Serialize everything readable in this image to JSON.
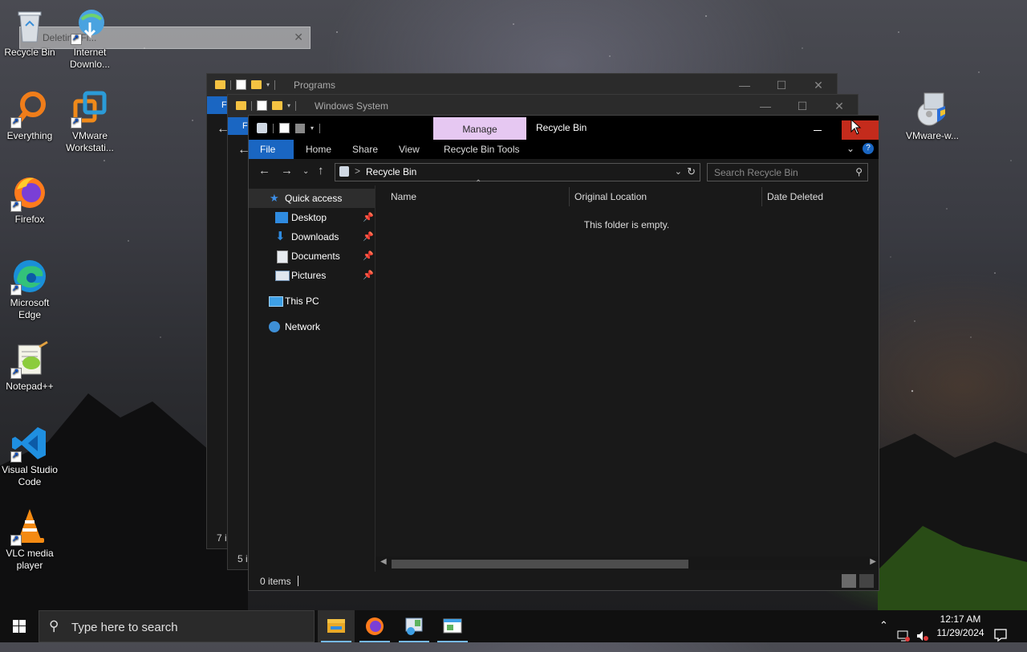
{
  "desktop": {
    "icons": [
      {
        "label": "Recycle Bin",
        "icon": "recycle-bin-icon"
      },
      {
        "label": "Internet Downlo...",
        "icon": "internet-download-manager-icon"
      },
      {
        "label": "Everything",
        "icon": "everything-search-icon"
      },
      {
        "label": "VMware Workstati...",
        "icon": "vmware-workstation-icon"
      },
      {
        "label": "Firefox",
        "icon": "firefox-icon"
      },
      {
        "label": "Microsoft Edge",
        "icon": "edge-icon"
      },
      {
        "label": "Notepad++",
        "icon": "notepad-plus-plus-icon"
      },
      {
        "label": "Visual Studio Code",
        "icon": "vscode-icon"
      },
      {
        "label": "VLC media player",
        "icon": "vlc-icon"
      },
      {
        "label": "VMware-w...",
        "icon": "vmware-installer-icon"
      }
    ],
    "ghost_dialog_title": "Deleting Fi..."
  },
  "windows": {
    "programs": {
      "title": "Programs",
      "file_tab": "F",
      "status": "7 i"
    },
    "windows_system": {
      "title": "Windows System",
      "file_tab": "F",
      "status": "5 i"
    }
  },
  "explorer": {
    "title": "Recycle Bin",
    "manage_label": "Manage",
    "ribbon_tabs": [
      "File",
      "Home",
      "Share",
      "View",
      "Recycle Bin Tools"
    ],
    "help_label": "?",
    "address": {
      "separator": ">",
      "path": "Recycle Bin"
    },
    "search_placeholder": "Search Recycle Bin",
    "nav": {
      "quick_access": "Quick access",
      "pinned": [
        "Desktop",
        "Downloads",
        "Documents",
        "Pictures"
      ],
      "this_pc": "This PC",
      "network": "Network"
    },
    "columns": [
      "Name",
      "Original Location",
      "Date Deleted"
    ],
    "empty_message": "This folder is empty.",
    "status": "0 items"
  },
  "taskbar": {
    "search_placeholder": "Type here to search",
    "apps": [
      "file-explorer-icon",
      "firefox-icon",
      "control-panel-icon",
      "app-window-icon"
    ],
    "time": "12:17 AM",
    "date": "11/29/2024"
  },
  "colors": {
    "accent": "#1a66c2",
    "manage_tab": "#e6c8f2",
    "close_red": "#c42b1c"
  }
}
